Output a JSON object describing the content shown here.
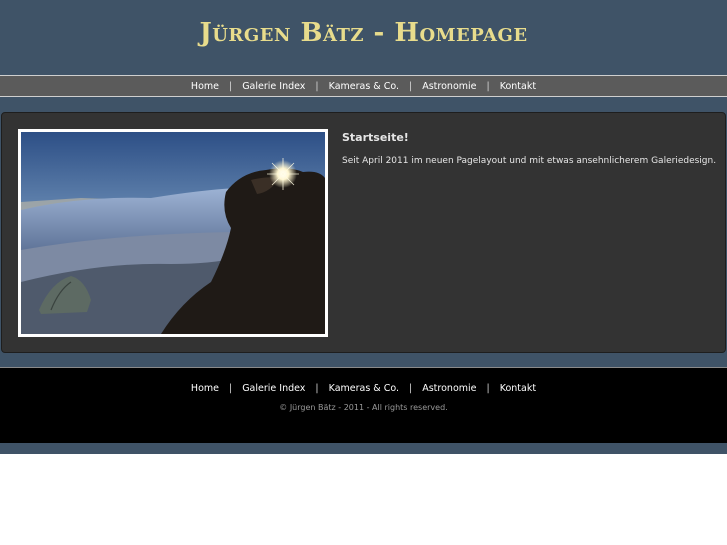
{
  "header": {
    "title": "Jürgen Bätz - Homepage"
  },
  "nav": {
    "items": [
      {
        "label": "Home"
      },
      {
        "label": "Galerie Index"
      },
      {
        "label": "Kameras & Co."
      },
      {
        "label": "Astronomie"
      },
      {
        "label": "Kontakt"
      }
    ],
    "separator": "|"
  },
  "main": {
    "heading": "Startseite!",
    "text": "Seit April 2011 im neuen Pagelayout und mit etwas ansehnlicherem Galeriedesign."
  },
  "footer": {
    "nav": [
      {
        "label": "Home"
      },
      {
        "label": "Galerie Index"
      },
      {
        "label": "Kameras & Co."
      },
      {
        "label": "Astronomie"
      },
      {
        "label": "Kontakt"
      }
    ],
    "copyright": "© Jürgen Bätz - 2011 - All rights reserved."
  },
  "colors": {
    "background": "#3f5367",
    "title": "#e8dc8c",
    "panel": "#333333",
    "footer": "#000000"
  }
}
